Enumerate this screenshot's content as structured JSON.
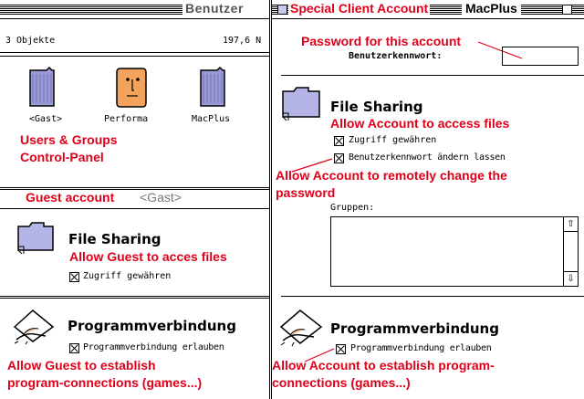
{
  "left_window": {
    "title": "Benutzer",
    "item_count": "3 Objekte",
    "disk_info": "197,6 N",
    "users": [
      {
        "label": "<Gast>"
      },
      {
        "label": "Performa"
      },
      {
        "label": "MacPlus"
      }
    ],
    "annotation_users": "Users & Groups",
    "annotation_cp": "Control-Panel",
    "guest_header_annot": "Guest account",
    "guest_header_name": "<Gast>",
    "file_sharing_title": "File Sharing",
    "annotation_guest_files": "Allow Guest to acces files",
    "checkbox_zugriff": "Zugriff gewähren",
    "programm_title": "Programmverbindung",
    "checkbox_programm": "Programmverbindung erlauben",
    "annotation_prog_1": "Allow Guest to establish",
    "annotation_prog_2": "program-connections (games...)"
  },
  "right_window": {
    "title_annot": "Special Client Account",
    "title_name": "MacPlus",
    "annotation_password": "Password for this account",
    "password_label": "Benutzerkennwort:",
    "file_sharing_title": "File Sharing",
    "annotation_files": "Allow Account to access files",
    "checkbox_zugriff": "Zugriff gewähren",
    "checkbox_kennwort": "Benutzerkennwort ändern lassen",
    "annotation_change_1": "Allow Account to remotely change the",
    "annotation_change_2": "password",
    "groups_label": "Gruppen:",
    "programm_title": "Programmverbindung",
    "checkbox_programm": "Programmverbindung erlauben",
    "annotation_prog_1": "Allow Account to establish program-",
    "annotation_prog_2": "connections (games...)"
  },
  "colors": {
    "annotation": "#e0001a",
    "folder": "#9a9ad6",
    "face": "#f4a35c"
  },
  "icons": [
    "user-group-icon",
    "user-face-icon",
    "folder-icon",
    "handshake-icon",
    "close-box-icon",
    "zoom-box-icon",
    "scroll-up-arrow-icon",
    "scroll-down-arrow-icon"
  ]
}
